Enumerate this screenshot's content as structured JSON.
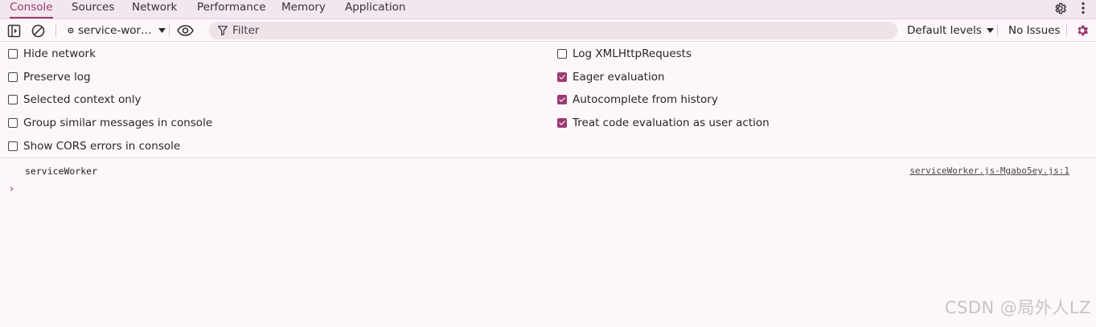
{
  "tabs": [
    {
      "label": "Console",
      "active": true
    },
    {
      "label": "Sources"
    },
    {
      "label": "Network"
    },
    {
      "label": "Performance"
    },
    {
      "label": "Memory"
    },
    {
      "label": "Application"
    }
  ],
  "toolbar": {
    "context": "service-wor…",
    "filter_placeholder": "Filter",
    "levels": "Default levels",
    "issues": "No Issues"
  },
  "settings": {
    "left": [
      {
        "label": "Hide network",
        "checked": false
      },
      {
        "label": "Preserve log",
        "checked": false
      },
      {
        "label": "Selected context only",
        "checked": false
      },
      {
        "label": "Group similar messages in console",
        "checked": false
      },
      {
        "label": "Show CORS errors in console",
        "checked": false
      }
    ],
    "right": [
      {
        "label": "Log XMLHttpRequests",
        "checked": false
      },
      {
        "label": "Eager evaluation",
        "checked": true
      },
      {
        "label": "Autocomplete from history",
        "checked": true
      },
      {
        "label": "Treat code evaluation as user action",
        "checked": true
      }
    ]
  },
  "console": {
    "message": "serviceWorker",
    "source": "serviceWorker.js-Mgabo5ey.js:1",
    "prompt": "›"
  },
  "watermark": "CSDN @局外人LZ",
  "colors": {
    "accent": "#9c3a71",
    "tabbar_bg": "#f3e7ef",
    "panel_bg": "#fdf7fb"
  }
}
